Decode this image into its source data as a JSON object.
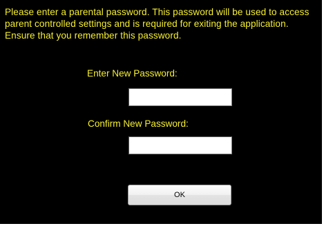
{
  "dialog": {
    "message": "Please enter a parental password. This password will be used to access parent controlled settings and is required for exiting the application. Ensure that you remember this password.",
    "new_password_label": "Enter New Password:",
    "new_password_value": "",
    "confirm_password_label": "Confirm New Password:",
    "confirm_password_value": "",
    "ok_label": "OK"
  },
  "colors": {
    "background": "#000000",
    "text": "#f6ef2e",
    "field_background": "#ffffff"
  }
}
